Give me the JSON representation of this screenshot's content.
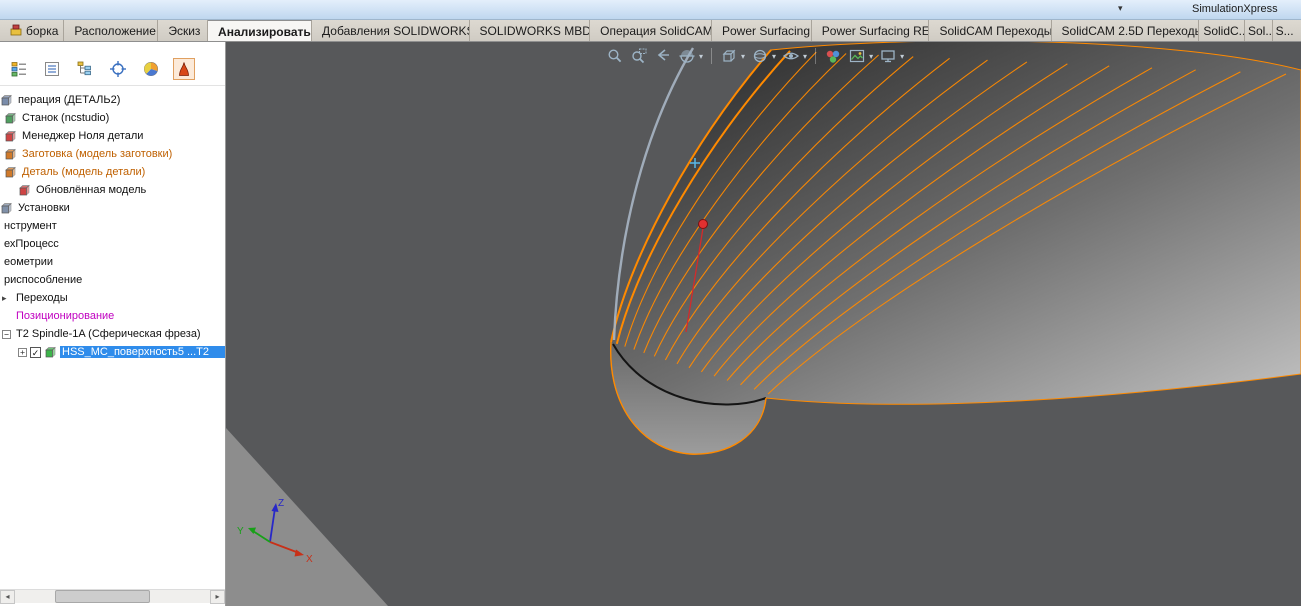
{
  "window": {
    "simulationxpress_label": "SimulationXpress"
  },
  "icons": {
    "dropdown_caret": "▾",
    "scroll_left": "◂",
    "scroll_right": "▸",
    "expander_plus": "+",
    "expander_minus": "−",
    "expander_arrow": "▸",
    "checkbox_check": "✓"
  },
  "tabs": [
    {
      "label": "борка",
      "active": false,
      "icon": "assembly-icon"
    },
    {
      "label": "Расположение",
      "active": false
    },
    {
      "label": "Эскиз",
      "active": false
    },
    {
      "label": "Анализировать",
      "active": true
    },
    {
      "label": "Добавления SOLIDWORKS",
      "active": false
    },
    {
      "label": "SOLIDWORKS MBD",
      "active": false
    },
    {
      "label": "Операция  SolidCAM",
      "active": false
    },
    {
      "label": "Power Surfacing",
      "active": false
    },
    {
      "label": "Power Surfacing RE",
      "active": false
    },
    {
      "label": "SolidCAM Переходы",
      "active": false
    },
    {
      "label": "SolidCAM 2.5D Переходы",
      "active": false
    },
    {
      "label": "SolidC...",
      "active": false
    },
    {
      "label": "Sol...",
      "active": false
    },
    {
      "label": "S...",
      "active": false
    }
  ],
  "panel_toolbar": [
    {
      "name": "featuremanager-tree-icon",
      "active": false
    },
    {
      "name": "propertymanager-icon",
      "active": false
    },
    {
      "name": "configurationmanager-icon",
      "active": false
    },
    {
      "name": "dimxpertmanager-icon",
      "active": false
    },
    {
      "name": "displaymanager-icon",
      "active": false
    },
    {
      "name": "solidcam-manager-icon",
      "active": true
    }
  ],
  "tree": {
    "items": [
      {
        "label": "перация (ДЕТАЛЬ2)",
        "icon": "operation-icon",
        "icon_color": "#7a8caa",
        "indent": 0
      },
      {
        "label": "Станок (ncstudio)",
        "icon": "machine-icon",
        "icon_color": "#4f9f5f",
        "indent": 4
      },
      {
        "label": "Менеджер Ноля детали",
        "icon": "zero-manager-icon",
        "icon_color": "#cf4444",
        "indent": 4
      },
      {
        "label": "Заготовка (модель заготовки)",
        "icon": "stock-model-icon",
        "icon_color": "#d07a2a",
        "indent": 4,
        "color": "#bf6000"
      },
      {
        "label": "Деталь (модель детали)",
        "icon": "target-model-icon",
        "icon_color": "#d07a2a",
        "indent": 4,
        "color": "#bf6000"
      },
      {
        "label": "Обновлённая модель",
        "icon": "updated-model-icon",
        "icon_color": "#cf4444",
        "indent": 18
      },
      {
        "label": "Установки",
        "icon": "setups-icon",
        "icon_color": "#8090a8",
        "indent": 0
      },
      {
        "label": "нструмент",
        "indent": 2
      },
      {
        "label": "ехПроцесс",
        "indent": 2
      },
      {
        "label": "еометрии",
        "indent": 2
      },
      {
        "label": "риспособление",
        "indent": 2
      },
      {
        "label": "Переходы",
        "expander": "arrow",
        "indent": 2
      },
      {
        "label": "Позиционирование",
        "indent": 14,
        "color": "#c000c0"
      },
      {
        "label": "T2 Spindle-1A  (Сферическая фреза)",
        "expander": "minus",
        "indent": 2
      },
      {
        "label": "HSS_MC_поверхность5 ...T2",
        "expander": "plus",
        "checkbox": true,
        "icon": "surface-operation-icon",
        "icon_color": "#3db54a",
        "indent": 18,
        "selected": true
      }
    ]
  },
  "viewport": {
    "toolbar": [
      {
        "name": "zoom-fit-icon",
        "dropdown": false
      },
      {
        "name": "zoom-area-icon",
        "dropdown": false
      },
      {
        "name": "previous-view-icon",
        "dropdown": false
      },
      {
        "name": "section-view-icon",
        "dropdown": true
      },
      {
        "name": "view-orientation-icon",
        "dropdown": true
      },
      {
        "name": "display-style-icon",
        "dropdown": true
      },
      {
        "name": "hide-show-items-icon",
        "dropdown": true
      },
      {
        "name": "edit-appearance-icon",
        "dropdown": false
      },
      {
        "name": "apply-scene-icon",
        "dropdown": true
      },
      {
        "name": "view-settings-icon",
        "dropdown": true
      }
    ],
    "triad": {
      "x_label": "X",
      "y_label": "Y",
      "z_label": "Z"
    },
    "colors": {
      "background": "#57585a",
      "ground": "#8d8d8d",
      "toolpath": "#ff8a00",
      "guide_curve": "#a9b6c4",
      "marker": "#d42a2a",
      "selection": "#2f8ceb"
    }
  }
}
